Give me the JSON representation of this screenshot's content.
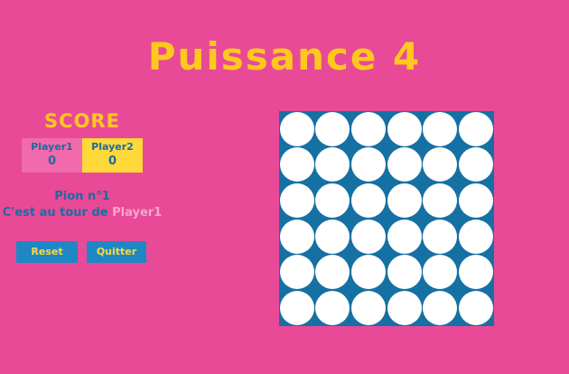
{
  "title": "Puissance 4",
  "score": {
    "heading": "SCORE",
    "player1": {
      "name": "Player1",
      "value": "0"
    },
    "player2": {
      "name": "Player2",
      "value": "0"
    }
  },
  "status": {
    "pion": "Pion n°1",
    "turn_prefix": "C'est au tour de ",
    "current_player": "Player1"
  },
  "buttons": {
    "reset": "Reset",
    "quit": "Quitter"
  },
  "board": {
    "rows": 6,
    "cols": 6,
    "cells": [
      [
        "empty",
        "empty",
        "empty",
        "empty",
        "empty",
        "empty"
      ],
      [
        "empty",
        "empty",
        "empty",
        "empty",
        "empty",
        "empty"
      ],
      [
        "empty",
        "empty",
        "empty",
        "empty",
        "empty",
        "empty"
      ],
      [
        "empty",
        "empty",
        "empty",
        "empty",
        "empty",
        "empty"
      ],
      [
        "empty",
        "empty",
        "empty",
        "empty",
        "empty",
        "empty"
      ],
      [
        "empty",
        "empty",
        "empty",
        "empty",
        "empty",
        "empty"
      ]
    ]
  },
  "colors": {
    "background": "#e84a97",
    "accent": "#ffc81f",
    "board": "#1570a3",
    "text": "#1f6a9e",
    "button": "#1e88c7"
  }
}
